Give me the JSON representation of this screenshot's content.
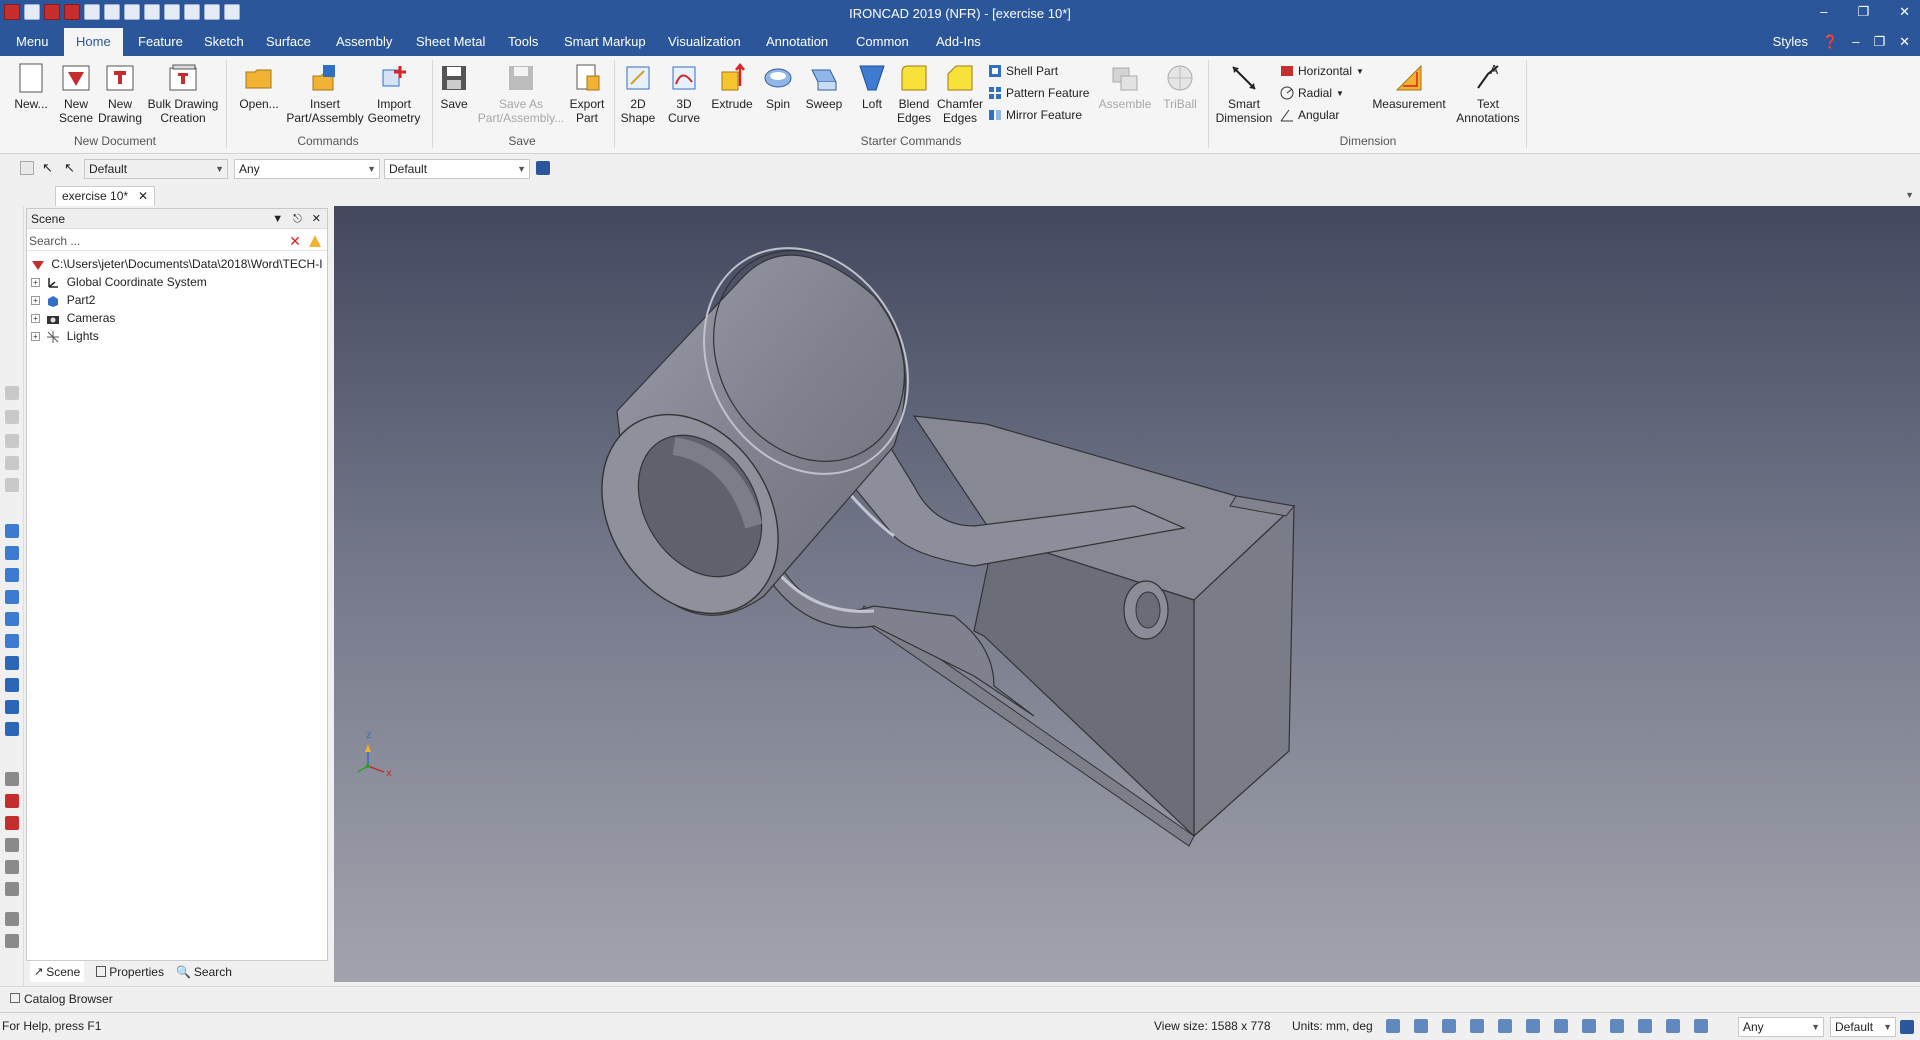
{
  "window": {
    "title": "IRONCAD 2019 (NFR) - [exercise 10*]"
  },
  "tabs": [
    "Menu",
    "Home",
    "Feature",
    "Sketch",
    "Surface",
    "Assembly",
    "Sheet Metal",
    "Tools",
    "Smart Markup",
    "Visualization",
    "Annotation",
    "Common",
    "Add-Ins"
  ],
  "tabs_right": {
    "styles": "Styles"
  },
  "ribbon": {
    "new_document": {
      "new": "New...",
      "new_scene": [
        "New",
        "Scene"
      ],
      "new_drawing": [
        "New",
        "Drawing"
      ],
      "bulk": [
        "Bulk Drawing",
        "Creation"
      ],
      "label": "New Document"
    },
    "commands": {
      "open": "Open...",
      "insert": [
        "Insert",
        "Part/Assembly"
      ],
      "import": [
        "Import",
        "Geometry"
      ],
      "label": "Commands"
    },
    "save": {
      "save": "Save",
      "save_as": [
        "Save As",
        "Part/Assembly..."
      ],
      "export": [
        "Export",
        "Part"
      ],
      "label": "Save"
    },
    "starter": {
      "shape2d": [
        "2D",
        "Shape"
      ],
      "curve3d": [
        "3D",
        "Curve"
      ],
      "extrude": "Extrude",
      "spin": "Spin",
      "sweep": "Sweep",
      "loft": "Loft",
      "blend": [
        "Blend",
        "Edges"
      ],
      "chamfer": [
        "Chamfer",
        "Edges"
      ],
      "shell": "Shell Part",
      "pattern": "Pattern Feature",
      "mirror": "Mirror Feature",
      "assemble": "Assemble",
      "triball": "TriBall",
      "label": "Starter Commands"
    },
    "dimension": {
      "smart": [
        "Smart",
        "Dimension"
      ],
      "horizontal": "Horizontal",
      "radial": "Radial",
      "angular": "Angular",
      "measurement": "Measurement",
      "text": [
        "Text",
        "Annotations"
      ],
      "label": "Dimension"
    }
  },
  "toolstrip": {
    "combo1": "Default",
    "combo2": "Any",
    "combo3": "Default"
  },
  "document_tab": "exercise 10*",
  "scene_panel": {
    "title": "Scene",
    "search_placeholder": "Search ...",
    "root": "C:\\Users\\jeter\\Documents\\Data\\2018\\Word\\TECH-I",
    "nodes": [
      "Global Coordinate System",
      "Part2",
      "Cameras",
      "Lights"
    ]
  },
  "panel_tabs": [
    "Scene",
    "Properties",
    "Search"
  ],
  "catalog_browser": "Catalog Browser",
  "triad": {
    "z": "z",
    "x": "x"
  },
  "status": {
    "help": "For Help, press F1",
    "view_size": "View size: 1588 x  778",
    "units": "Units: mm, deg",
    "combo1": "Any",
    "combo2": "Default"
  },
  "colors": {
    "accent": "#2b579a",
    "part": "#7d7f8c"
  }
}
